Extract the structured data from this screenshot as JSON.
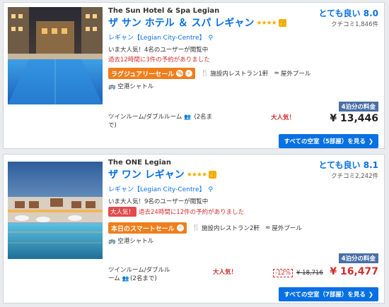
{
  "hotels": [
    {
      "name_en": "The Sun Hotel & Spa Legian",
      "name_jp": "ザ サン ホテル ＆ スパ レギャン",
      "stars": "★★★★",
      "location": "レギャン【Legian City-Centre】",
      "popularity": "いま大人気！4名のユーザーが閲覧中",
      "booking": "過去12時間に3件の予約がありました",
      "hot_badge": "",
      "deal_label": "ラグジュアリーセール",
      "amenity_restaurant": "施設内レストラン1軒",
      "amenity_pool": "屋外プール",
      "amenity_shuttle": "空港シャトル",
      "room_line1": "ツインルーム/ダブルルーム",
      "room_line2": "(2名ま",
      "room_line3": "で)",
      "popular_tag": "大人気！",
      "rating": "とても良い 8.0",
      "reviews": "クチコミ1,846件",
      "nights": "4泊分の料金",
      "price": "¥ 13,446",
      "discount": "",
      "old_price": "",
      "cta": "すべての空室（5部屋）を見る",
      "cta_chevron": "❯"
    },
    {
      "name_en": "The ONE Legian",
      "name_jp": "ザ ワン レギャン",
      "stars": "★★★★",
      "location": "レギャン【Legian City-Centre】",
      "popularity": "いま大人気！9名のユーザーが閲覧中",
      "booking": "過去24時間に12件の予約がありました",
      "hot_badge": "大人気！",
      "deal_label": "本日のスマートセール",
      "amenity_restaurant": "施設内レストラン2軒",
      "amenity_pool": "屋外プール",
      "amenity_shuttle": "空港シャトル",
      "room_line1": "ツインルーム/ダブルル",
      "room_line2": "ーム",
      "room_line3": "(2名まで)",
      "popular_tag": "大人気！",
      "rating": "とても良い 8.1",
      "reviews": "クチコミ2,242件",
      "nights": "4泊分の料金",
      "price": "¥ 16,477",
      "discount": "-12%",
      "old_price": "¥ 18,716",
      "cta": "すべての空室（7部屋）を見る",
      "cta_chevron": "❯"
    }
  ],
  "icons": {
    "thumb": "thumbs-up-icon",
    "pin": "map-pin-icon",
    "restaurant": "fork-knife-icon",
    "pool": "swimmer-icon",
    "shuttle": "shuttle-bus-icon",
    "people": "people-icon"
  },
  "colors": {
    "link_blue": "#0770e3",
    "deal_orange": "#ef7e1c",
    "alert_red": "#d32f2f",
    "star_gold": "#f3ad00",
    "nights_badge": "#4a6fa5"
  }
}
